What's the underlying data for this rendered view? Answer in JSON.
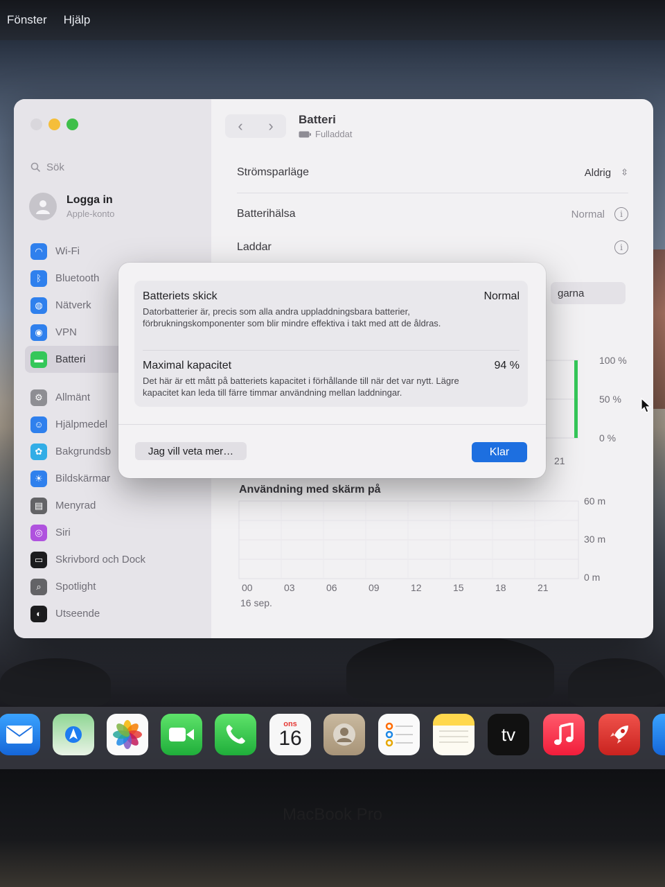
{
  "menubar": {
    "items": [
      "Fönster",
      "Hjälp"
    ]
  },
  "sidebar": {
    "search_placeholder": "Sök",
    "account": {
      "title": "Logga in",
      "subtitle": "Apple-konto"
    },
    "items": [
      {
        "label": "Wi-Fi",
        "icon": "wifi-icon",
        "color": "#2f80ed"
      },
      {
        "label": "Bluetooth",
        "icon": "bluetooth-icon",
        "color": "#2f80ed"
      },
      {
        "label": "Nätverk",
        "icon": "globe-icon",
        "color": "#2f80ed"
      },
      {
        "label": "VPN",
        "icon": "vpn-icon",
        "color": "#2f80ed"
      },
      {
        "label": "Batteri",
        "icon": "battery-icon",
        "color": "#34c759"
      },
      {
        "label": "Allmänt",
        "icon": "gear-icon",
        "color": "#8e8e93"
      },
      {
        "label": "Hjälpmedel",
        "icon": "accessibility-icon",
        "color": "#2f80ed"
      },
      {
        "label": "Bakgrundsb",
        "icon": "wallpaper-icon",
        "color": "#32ade6"
      },
      {
        "label": "Bildskärmar",
        "icon": "display-icon",
        "color": "#2f80ed"
      },
      {
        "label": "Menyrad",
        "icon": "menubar-icon",
        "color": "#636366"
      },
      {
        "label": "Siri",
        "icon": "siri-icon",
        "color": "#af52de"
      },
      {
        "label": "Skrivbord och Dock",
        "icon": "dock-icon",
        "color": "#1c1c1e"
      },
      {
        "label": "Spotlight",
        "icon": "spotlight-icon",
        "color": "#636366"
      },
      {
        "label": "Utseende",
        "icon": "appearance-icon",
        "color": "#1c1c1e"
      }
    ]
  },
  "window": {
    "title": "Batteri",
    "subtitle": "Fulladdat"
  },
  "settings": {
    "power_mode_label": "Strömsparläge",
    "power_mode_value": "Aldrig",
    "health_label": "Batterihälsa",
    "health_value": "Normal",
    "charging_label": "Laddar",
    "partial_button": "garna"
  },
  "mini_chart": {
    "labels": [
      "100 %",
      "50 %",
      "0 %"
    ],
    "tick": "21"
  },
  "usage_chart": {
    "title": "Användning med skärm på",
    "y_labels": [
      "60 m",
      "30 m",
      "0 m"
    ],
    "x_labels": [
      "00",
      "03",
      "06",
      "09",
      "12",
      "15",
      "18",
      "21"
    ],
    "date": "16 sep."
  },
  "modal": {
    "condition_title": "Batteriets skick",
    "condition_value": "Normal",
    "condition_desc": "Datorbatterier är, precis som alla andra uppladdningsbara batterier, förbrukningskomponenter som blir mindre effektiva i takt med att de åldras.",
    "capacity_title": "Maximal kapacitet",
    "capacity_value": "94 %",
    "capacity_desc": "Det här är ett mått på batteriets kapacitet i förhållande till när det var nytt. Lägre kapacitet kan leda till färre timmar användning mellan laddningar.",
    "more_button": "Jag vill veta mer…",
    "done_button": "Klar"
  },
  "dock": {
    "calendar_day": "ons",
    "calendar_date": "16",
    "tv_label": "tv"
  },
  "bezel": {
    "brand": "MacBook Pro"
  },
  "colors": {
    "accent": "#1d6fe0",
    "battery_green": "#34c759"
  }
}
